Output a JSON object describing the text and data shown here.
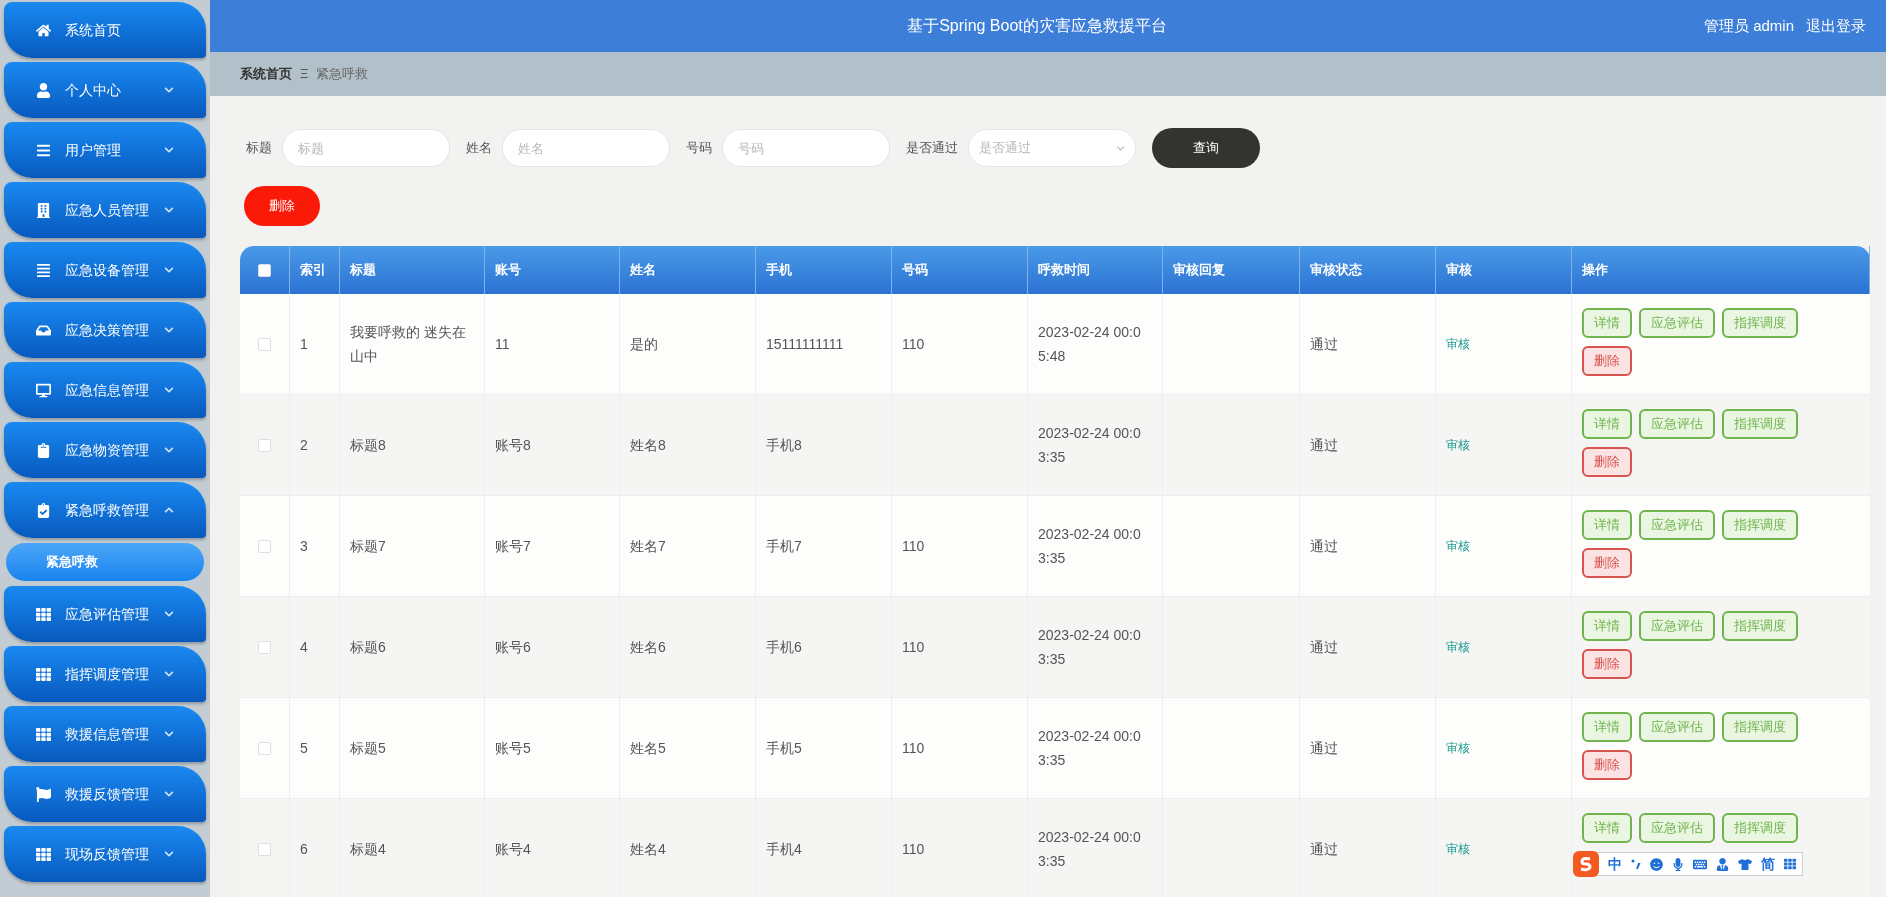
{
  "header": {
    "title": "基于Spring Boot的灾害应急救援平台",
    "user": "管理员 admin",
    "logout": "退出登录"
  },
  "sidebar": {
    "items": [
      {
        "label": "系统首页",
        "kind": "link"
      },
      {
        "label": "个人中心",
        "kind": "menu",
        "expanded": false
      },
      {
        "label": "用户管理",
        "kind": "menu",
        "expanded": false
      },
      {
        "label": "应急人员管理",
        "kind": "menu",
        "expanded": false
      },
      {
        "label": "应急设备管理",
        "kind": "menu",
        "expanded": false
      },
      {
        "label": "应急决策管理",
        "kind": "menu",
        "expanded": false
      },
      {
        "label": "应急信息管理",
        "kind": "menu",
        "expanded": false
      },
      {
        "label": "应急物资管理",
        "kind": "menu",
        "expanded": false
      },
      {
        "label": "紧急呼救管理",
        "kind": "menu",
        "expanded": true,
        "children": [
          {
            "label": "紧急呼救",
            "selected": true
          }
        ]
      },
      {
        "label": "应急评估管理",
        "kind": "menu",
        "expanded": false
      },
      {
        "label": "指挥调度管理",
        "kind": "menu",
        "expanded": false
      },
      {
        "label": "救援信息管理",
        "kind": "menu",
        "expanded": false
      },
      {
        "label": "救援反馈管理",
        "kind": "menu",
        "expanded": false
      },
      {
        "label": "现场反馈管理",
        "kind": "menu",
        "expanded": false
      }
    ]
  },
  "breadcrumb": {
    "items": [
      "系统首页",
      "紧急呼救"
    ],
    "separator": "Ξ"
  },
  "search": {
    "fields": [
      {
        "label": "标题",
        "placeholder": "标题",
        "kind": "input"
      },
      {
        "label": "姓名",
        "placeholder": "姓名",
        "kind": "input"
      },
      {
        "label": "号码",
        "placeholder": "号码",
        "kind": "input"
      },
      {
        "label": "是否通过",
        "placeholder": "是否通过",
        "kind": "select"
      }
    ],
    "button": "查询"
  },
  "delete_button": "删除",
  "table": {
    "select_all": {
      "checked": false
    },
    "columns": [
      "索引",
      "标题",
      "账号",
      "姓名",
      "手机",
      "号码",
      "呼救时间",
      "审核回复",
      "审核状态",
      "审核",
      "操作"
    ],
    "rows": [
      {
        "checked": false,
        "cells": [
          "1",
          "我要呼救的 迷失在山中",
          "11",
          "是的",
          "15111111111",
          "110",
          "2023-02-24 00:05:48",
          "",
          "通过"
        ],
        "review": "审核",
        "actions": [
          "详情",
          "应急评估",
          "指挥调度",
          "删除"
        ]
      },
      {
        "checked": false,
        "cells": [
          "2",
          "标题8",
          "账号8",
          "姓名8",
          "手机8",
          "",
          "2023-02-24 00:03:35",
          "",
          "通过"
        ],
        "review": "审核",
        "actions": [
          "详情",
          "应急评估",
          "指挥调度",
          "删除"
        ]
      },
      {
        "checked": false,
        "cells": [
          "3",
          "标题7",
          "账号7",
          "姓名7",
          "手机7",
          "110",
          "2023-02-24 00:03:35",
          "",
          "通过"
        ],
        "review": "审核",
        "actions": [
          "详情",
          "应急评估",
          "指挥调度",
          "删除"
        ]
      },
      {
        "checked": false,
        "cells": [
          "4",
          "标题6",
          "账号6",
          "姓名6",
          "手机6",
          "110",
          "2023-02-24 00:03:35",
          "",
          "通过"
        ],
        "review": "审核",
        "actions": [
          "详情",
          "应急评估",
          "指挥调度",
          "删除"
        ]
      },
      {
        "checked": false,
        "cells": [
          "5",
          "标题5",
          "账号5",
          "姓名5",
          "手机5",
          "110",
          "2023-02-24 00:03:35",
          "",
          "通过"
        ],
        "review": "审核",
        "actions": [
          "详情",
          "应急评估",
          "指挥调度",
          "删除"
        ]
      },
      {
        "checked": false,
        "cells": [
          "6",
          "标题4",
          "账号4",
          "姓名4",
          "手机4",
          "110",
          "2023-02-24 00:03:35",
          "",
          "通过"
        ],
        "review": "审核",
        "actions": [
          "详情",
          "应急评估",
          "指挥调度"
        ]
      }
    ]
  },
  "ime_bar": {
    "mode": "中",
    "script": "简"
  }
}
